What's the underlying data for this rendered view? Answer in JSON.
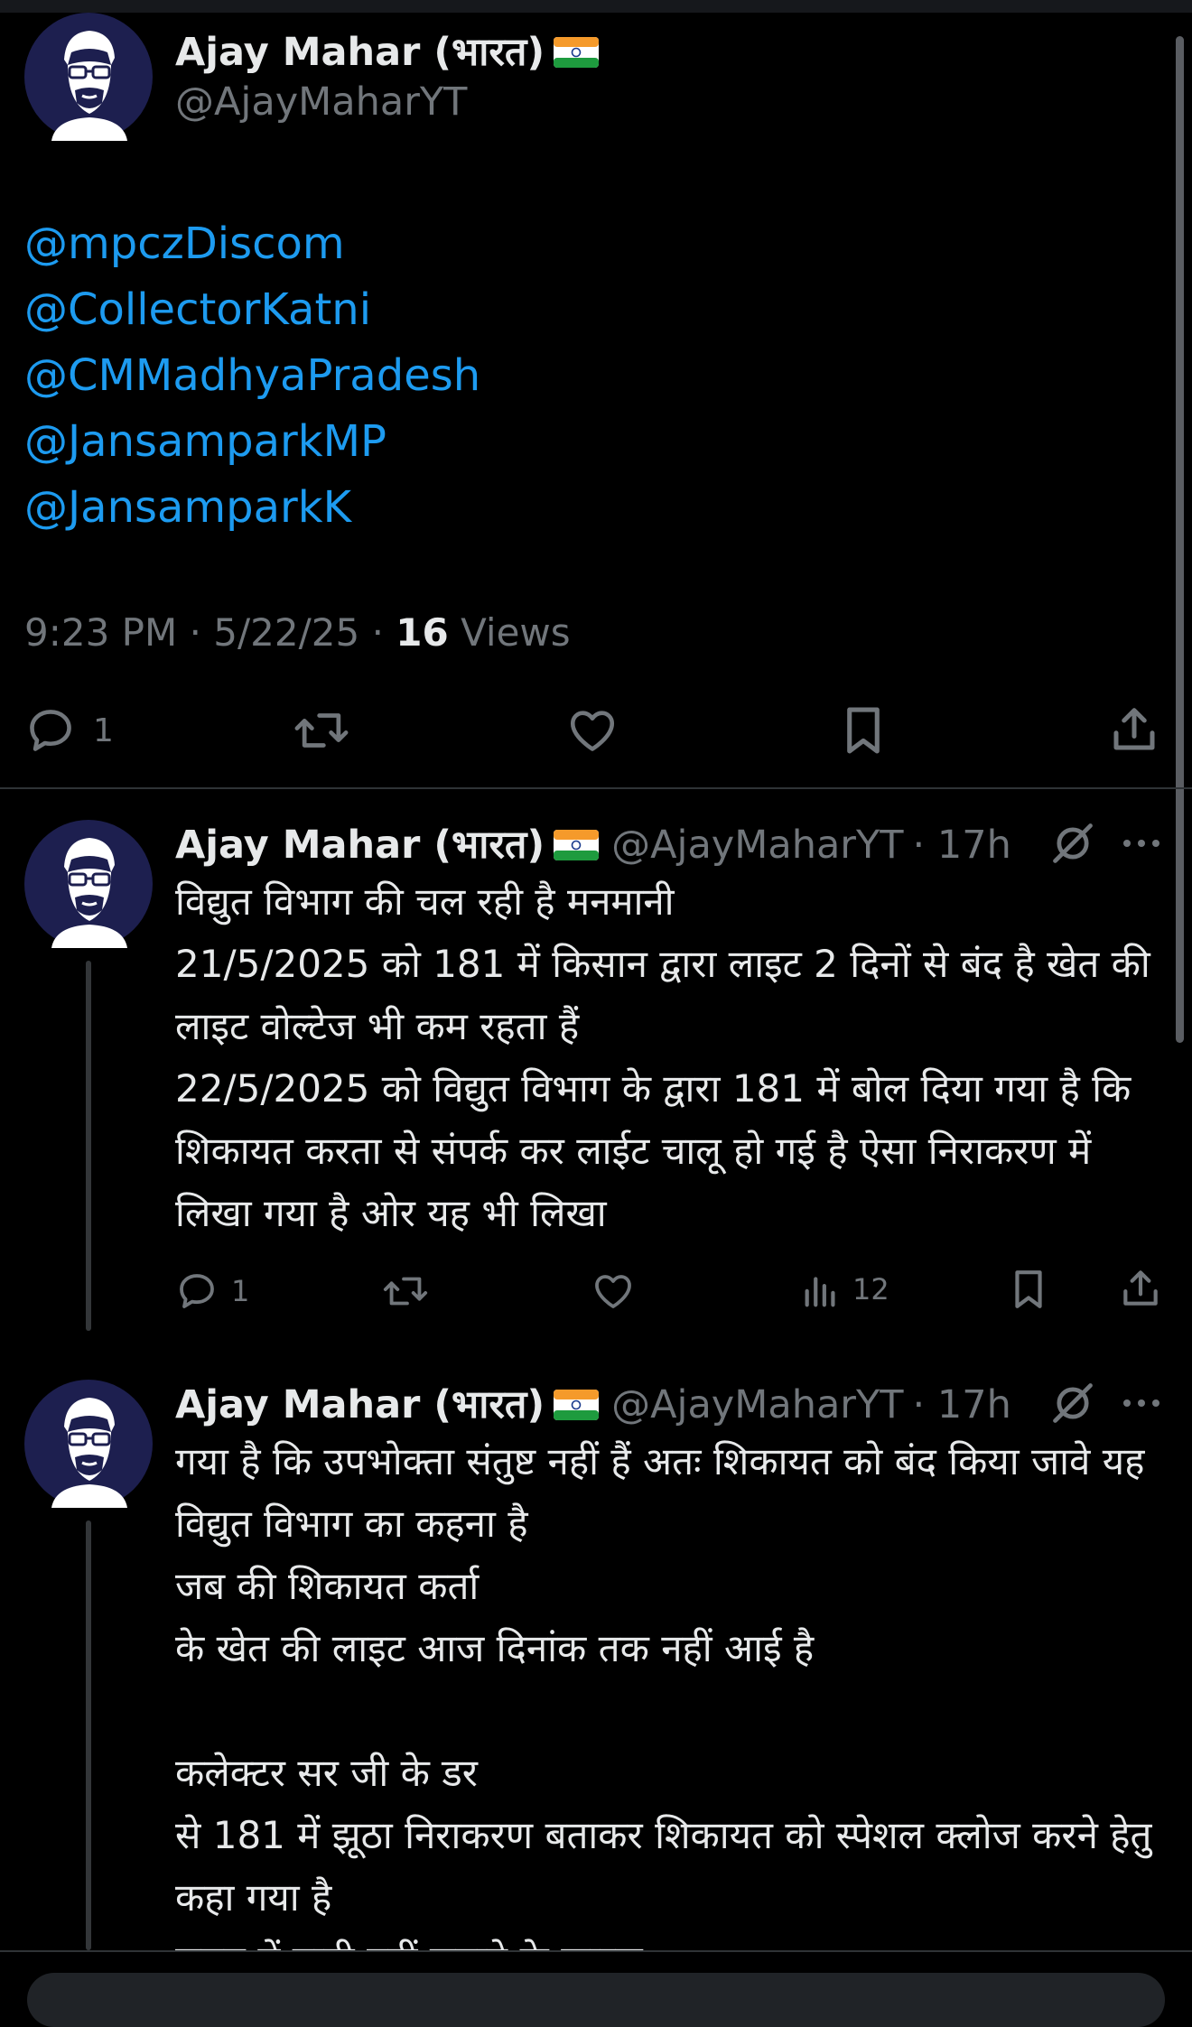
{
  "colors": {
    "background": "#000000",
    "text": "#e7e9ea",
    "muted": "#71767b",
    "link": "#1d9bf0",
    "avatar_bg": "#1d1f4f"
  },
  "main_tweet": {
    "name": "Ajay Mahar (भारत)",
    "flag_icon": "india-flag-icon",
    "handle": "@AjayMaharYT",
    "mentions": [
      "@mpczDiscom",
      "@CollectorKatni",
      "@CMMadhyaPradesh",
      "@JansamparkMP",
      "@JansamparkK"
    ],
    "time": "9:23 PM",
    "date": "5/22/25",
    "views_count": "16",
    "views_label": "Views",
    "actions": {
      "reply_count": "1",
      "reply_icon": "reply-icon",
      "retweet_icon": "retweet-icon",
      "like_icon": "heart-icon",
      "bookmark_icon": "bookmark-icon",
      "share_icon": "share-icon"
    }
  },
  "replies": [
    {
      "name": "Ajay Mahar (भारत)",
      "handle": "@AjayMaharYT",
      "time": "· 17h",
      "body": "विद्युत विभाग की चल रही है मनमानी\n21/5/2025 को 181 में किसान द्वारा लाइट 2 दिनों से बंद है खेत की लाइट वोल्टेज भी कम रहता हैं\n22/5/2025 को विद्युत विभाग के द्वारा 181 में बोल दिया गया है कि शिकायत करता से संपर्क कर  लाईट चालू हो गई है ऐसा निराकरण में  लिखा गया है ओर यह भी लिखा",
      "reply_count": "1",
      "views_count": "12"
    },
    {
      "name": "Ajay Mahar (भारत)",
      "handle": "@AjayMaharYT",
      "time": "· 17h",
      "body": "गया है कि उपभोक्ता संतुष्ट नहीं हैं अतः शिकायत को बंद किया जावे यह विद्युत विभाग का कहना है\nजब की शिकायत कर्ता\nके खेत की लाइट आज दिनांक तक नहीं आई है\n\nकलेक्टर सर जी के डर\nसे 181 में झूठा निराकरण बताकर शिकायत को स्पेशल क्लोज करने हेतु कहा गया है\nसमय में पानी नहीं लगाने के कारण"
    }
  ]
}
